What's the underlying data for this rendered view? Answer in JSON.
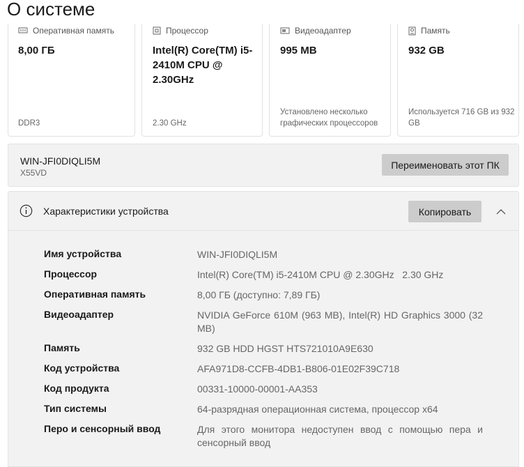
{
  "page_title": "О системе",
  "cards": [
    {
      "label": "Оперативная память",
      "icon": "ram-icon",
      "value": "8,00 ГБ",
      "footer": "DDR3"
    },
    {
      "label": "Процессор",
      "icon": "cpu-icon",
      "value": "Intel(R) Core(TM) i5-2410M CPU @ 2.30GHz",
      "footer": "2.30 GHz"
    },
    {
      "label": "Видеоадаптер",
      "icon": "gpu-icon",
      "value": "995 MB",
      "footer": "Установлено несколько графических процессоров"
    },
    {
      "label": "Память",
      "icon": "storage-icon",
      "value": "932 GB",
      "footer": "Используется 716 GB из 932 GB"
    }
  ],
  "device": {
    "name": "WIN-JFI0DIQLI5M",
    "model": "X55VD",
    "rename_button": "Переименовать этот ПК"
  },
  "specs": {
    "title": "Характеристики устройства",
    "copy_button": "Копировать",
    "rows": [
      {
        "label": "Имя устройства",
        "value": "WIN-JFI0DIQLI5M"
      },
      {
        "label": "Процессор",
        "value": "Intel(R) Core(TM) i5-2410M CPU @ 2.30GHz   2.30 GHz"
      },
      {
        "label": "Оперативная память",
        "value": "8,00 ГБ (доступно: 7,89 ГБ)"
      },
      {
        "label": "Видеоадаптер",
        "value": "NVIDIA GeForce 610M (963 MB), Intel(R) HD Graphics 3000 (32 MB)"
      },
      {
        "label": "Память",
        "value": "932 GB HDD HGST HTS721010A9E630"
      },
      {
        "label": "Код устройства",
        "value": "AFA971D8-CCFB-4DB1-B806-01E02F39C718"
      },
      {
        "label": "Код продукта",
        "value": "00331-10000-00001-AA353"
      },
      {
        "label": "Тип системы",
        "value": "64-разрядная операционная система, процессор x64"
      },
      {
        "label": "Перо и сенсорный ввод",
        "value": "Для этого монитора недоступен ввод с помощью пера и сенсорный ввод"
      }
    ]
  }
}
